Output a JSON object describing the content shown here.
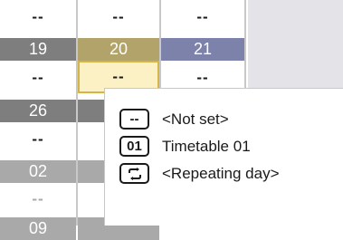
{
  "calendar": {
    "row0": [
      "--",
      "--",
      "--"
    ],
    "dates_row1": [
      "19",
      "20",
      "21"
    ],
    "row1": [
      "--",
      "--",
      "--"
    ],
    "dates_row2": [
      "26"
    ],
    "row2": [
      "--"
    ],
    "dates_row3": [
      "02"
    ],
    "row3": [
      "--"
    ],
    "dates_row4": [
      "09"
    ]
  },
  "legend": {
    "items": [
      {
        "icon_label": "--",
        "text": "<Not set>",
        "icon": "not-set-icon"
      },
      {
        "icon_label": "01",
        "text": "Timetable 01",
        "icon": "timetable-icon"
      },
      {
        "icon_label": "",
        "text": "<Repeating day>",
        "icon": "repeat-icon"
      }
    ]
  },
  "colors": {
    "date_dark": "#7e7e7e",
    "date_selected": "#b2a36a",
    "date_blue": "#7c82aa",
    "date_light": "#a9a9a9",
    "selected_fill": "#fbf1c4",
    "selected_border": "#d5b548",
    "panel": "#e4e4e8"
  }
}
